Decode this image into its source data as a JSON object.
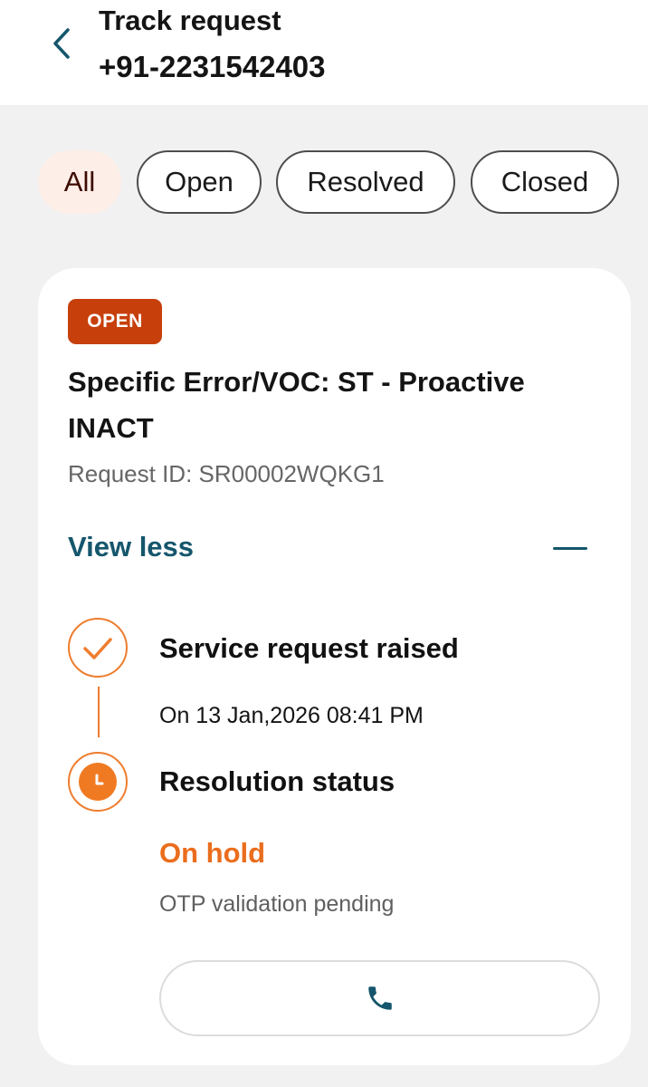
{
  "header": {
    "title": "Track request",
    "phone": "+91-2231542403"
  },
  "filters": [
    {
      "label": "All",
      "active": true
    },
    {
      "label": "Open",
      "active": false
    },
    {
      "label": "Resolved",
      "active": false
    },
    {
      "label": "Closed",
      "active": false
    }
  ],
  "request": {
    "status_badge": "OPEN",
    "title": "Specific Error/VOC: ST - Proactive INACT",
    "request_id": "Request ID: SR00002WQKG1",
    "toggle_label": "View less",
    "steps": [
      {
        "title": "Service request raised",
        "detail": "On 13 Jan,2026 08:41 PM",
        "icon": "check-icon",
        "state": "completed"
      },
      {
        "title": "Resolution status",
        "status": "On hold",
        "note": "OTP validation pending",
        "icon": "clock-icon",
        "state": "pending"
      }
    ],
    "call_icon": "phone-icon"
  },
  "colors": {
    "accent_teal": "#15566c",
    "badge_orange": "#c7400c",
    "timeline_orange": "#ef7d2e",
    "active_chip_bg": "#fdeee7"
  }
}
